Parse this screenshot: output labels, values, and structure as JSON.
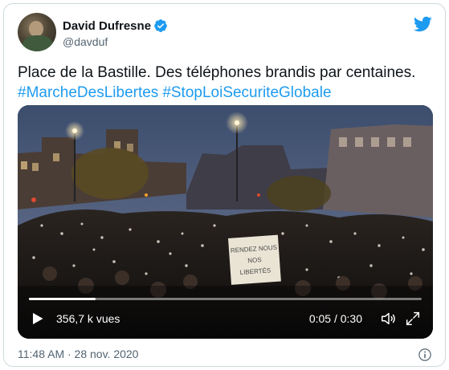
{
  "author": {
    "name": "David Dufresne",
    "handle": "@davduf",
    "verified": true
  },
  "tweet": {
    "text": "Place de la Bastille. Des téléphones brandis par centaines.",
    "hashtags": [
      "#MarcheDesLibertes",
      "#StopLoiSecuriteGlobale"
    ]
  },
  "video": {
    "views": "356,7 k vues",
    "time": "0:05 / 0:30",
    "progress": 0.17,
    "sign_text": [
      "RENDEZ NOUS",
      "NOS",
      "LIBERTÉS"
    ]
  },
  "footer": {
    "timestamp": "11:48 AM · 28 nov. 2020"
  },
  "colors": {
    "link": "#1d9bf0",
    "verified": "#1d9bf0",
    "twitter_blue": "#1d9bf0"
  },
  "icons": [
    "twitter-bird-icon",
    "verified-badge-icon",
    "play-icon",
    "volume-icon",
    "fullscreen-icon",
    "info-icon"
  ]
}
